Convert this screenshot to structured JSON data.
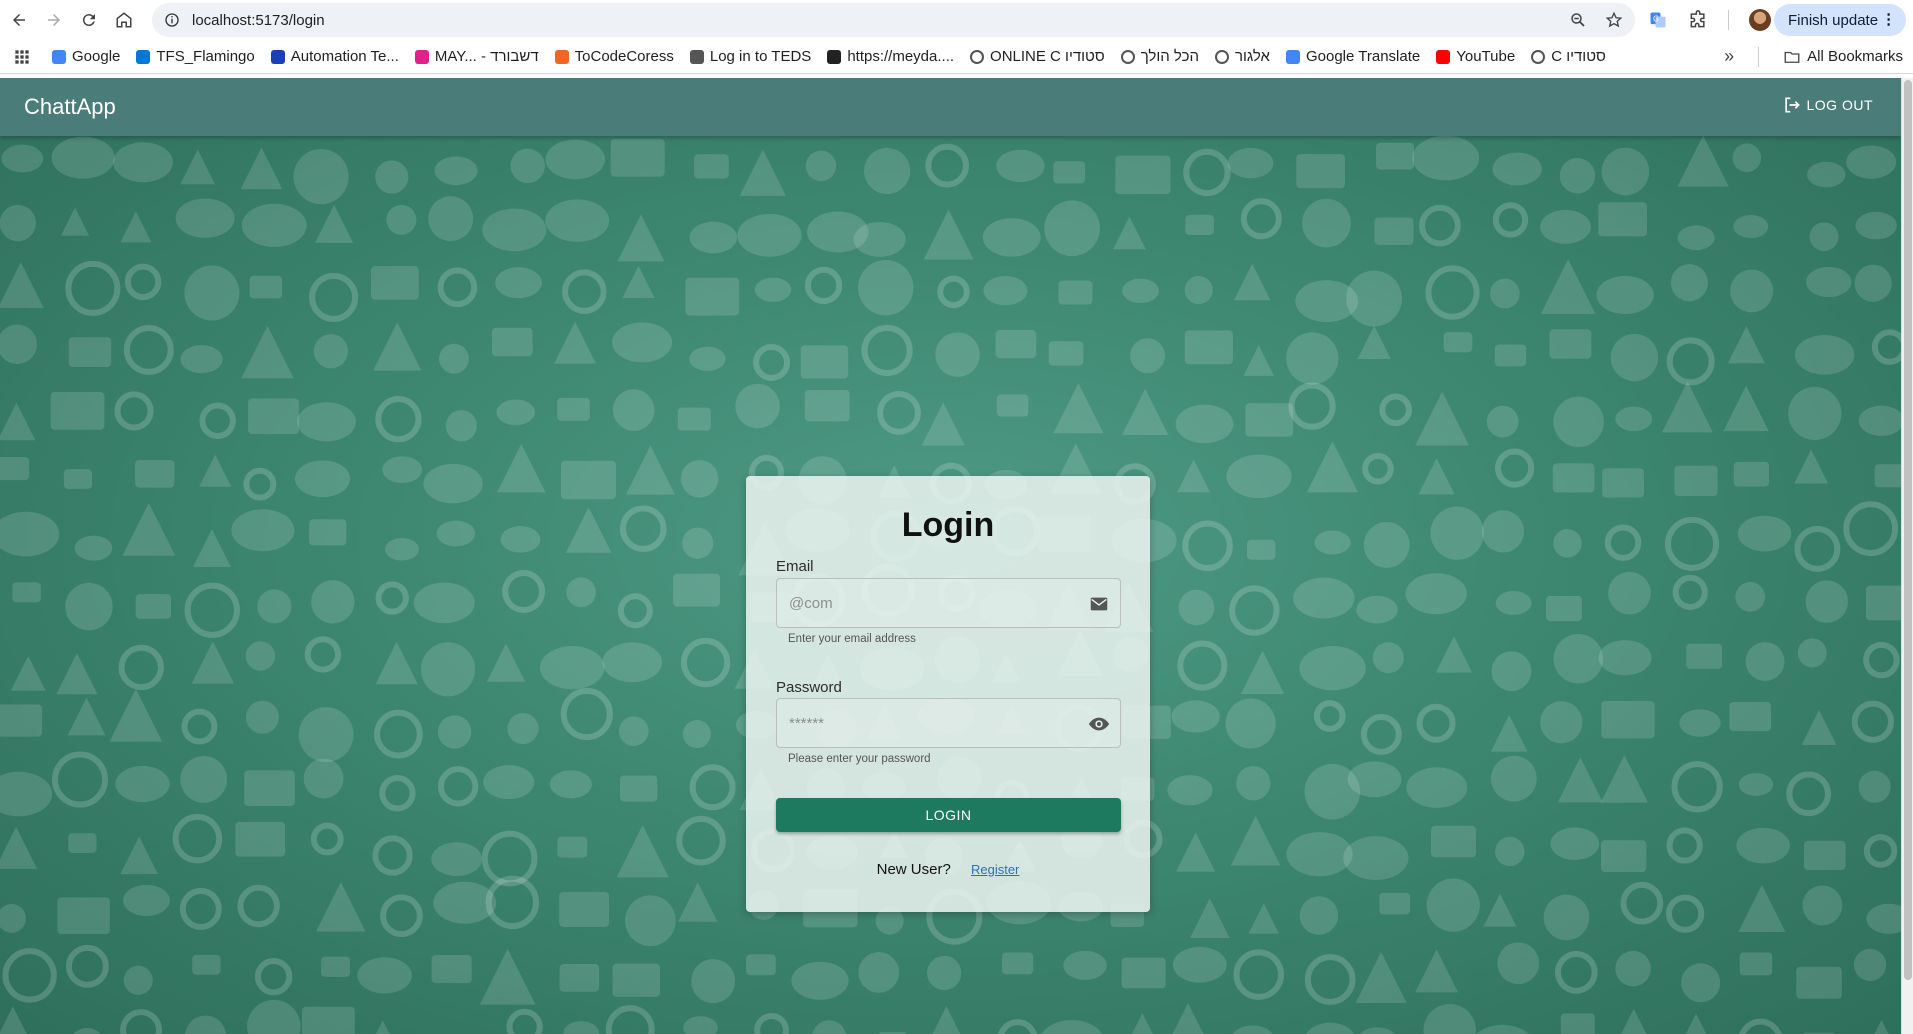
{
  "browser": {
    "url": "localhost:5173/login",
    "finish_update_label": "Finish update",
    "bookmarks": [
      {
        "label": "Google",
        "icon": "google-icon",
        "color": "#4285f4"
      },
      {
        "label": "TFS_Flamingo",
        "icon": "tfs-icon",
        "color": "#0078d4"
      },
      {
        "label": "Automation Te...",
        "icon": "automation-icon",
        "color": "#1a3fb8"
      },
      {
        "label": "MAY... - דשבורד",
        "icon": "heart-icon",
        "color": "#e0218a"
      },
      {
        "label": "ToCodeCoress",
        "icon": "tocode-icon",
        "color": "#f26522"
      },
      {
        "label": "Log in to TEDS",
        "icon": "teds-icon",
        "color": "#555555"
      },
      {
        "label": "https://meyda....",
        "icon": "meyda-icon",
        "color": "#222222"
      },
      {
        "label": "ONLINE C סטודיו",
        "icon": "globe-icon",
        "color": "#555555"
      },
      {
        "label": "הכל הולך",
        "icon": "globe-icon",
        "color": "#555555"
      },
      {
        "label": "אלגור",
        "icon": "globe-icon",
        "color": "#555555"
      },
      {
        "label": "Google Translate",
        "icon": "translate-icon",
        "color": "#4285f4"
      },
      {
        "label": "YouTube",
        "icon": "youtube-icon",
        "color": "#ff0000"
      },
      {
        "label": "C סטודיו",
        "icon": "globe-icon",
        "color": "#555555"
      }
    ],
    "all_bookmarks_label": "All Bookmarks",
    "overflow_label": "»"
  },
  "app": {
    "brand": "ChattApp",
    "logout_label": "LOG OUT",
    "accent_color": "#1e7a5f",
    "appbar_color": "#4a7c79"
  },
  "login": {
    "title": "Login",
    "email_label": "Email",
    "email_placeholder": "@com",
    "email_helper": "Enter your email address",
    "password_label": "Password",
    "password_placeholder": "******",
    "password_helper": "Please enter your password",
    "submit_label": "LOGIN",
    "new_user_text": "New User?",
    "register_label": "Register"
  }
}
